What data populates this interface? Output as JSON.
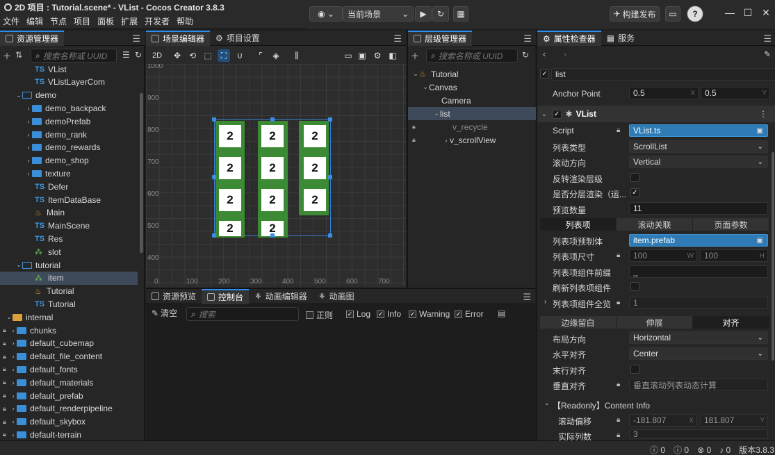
{
  "window": {
    "title": "2D 项目 : Tutorial.scene* - VList - Cocos Creator 3.8.3"
  },
  "menu": [
    "文件",
    "编辑",
    "节点",
    "项目",
    "面板",
    "扩展",
    "开发者",
    "帮助"
  ],
  "toolbar": {
    "scene_select": "当前场景",
    "build_label": "构建发布"
  },
  "assets": {
    "tab": "资源管理器",
    "search_placeholder": "搜索名称或 UUID",
    "rows": [
      "VList",
      "VListLayerCom",
      "demo",
      "demo_backpack",
      "demoPrefab",
      "demo_rank",
      "demo_rewards",
      "demo_shop",
      "texture",
      "Defer",
      "ItemDataBase",
      "Main",
      "MainScene",
      "Res",
      "slot",
      "tutorial",
      "item",
      "Tutorial",
      "Tutorial",
      "internal",
      "chunks",
      "default_cubemap",
      "default_file_content",
      "default_fonts",
      "default_materials",
      "default_prefab",
      "default_renderpipeline",
      "default_skybox",
      "default-terrain"
    ]
  },
  "scene": {
    "tab": "场景编辑器",
    "tab2": "项目设置",
    "mode": "2D",
    "yticks": [
      "1000",
      "900",
      "800",
      "700",
      "600",
      "500",
      "400"
    ],
    "xticks": [
      "0",
      "100",
      "200",
      "300",
      "400",
      "500",
      "600",
      "700"
    ],
    "cell_value": "2"
  },
  "hierarchy": {
    "tab": "层级管理器",
    "search_placeholder": "搜索名称或 UUID",
    "rows": [
      "Tutorial",
      "Canvas",
      "Camera",
      "list",
      "v_recycle",
      "v_scrollView"
    ]
  },
  "console": {
    "tabs": [
      "资源预览",
      "控制台",
      "动画编辑器",
      "动画图"
    ],
    "clear": "清空",
    "search_placeholder": "搜索",
    "regex": "正则",
    "filters": [
      "Log",
      "Info",
      "Warning",
      "Error"
    ]
  },
  "inspector": {
    "tabs": [
      "属性检查器",
      "服务"
    ],
    "node_name": "list",
    "anchor_label": "Anchor Point",
    "anchor_x": "0.5",
    "anchor_y": "0.5",
    "component": "VList",
    "script_label": "Script",
    "script_value": "VList.ts",
    "list_type_label": "列表类型",
    "list_type": "ScrollList",
    "scroll_dir_label": "滚动方向",
    "scroll_dir": "Vertical",
    "reverse_label": "反转渲染层级",
    "layered_label": "是否分层渲染（运...",
    "preview_label": "预览数量",
    "preview_count": "11",
    "seg1": [
      "列表项",
      "滚动关联",
      "页面参数"
    ],
    "prefab_label": "列表项预制体",
    "prefab_value": "item.prefab",
    "item_size_label": "列表项尺寸",
    "item_w": "100",
    "item_h": "100",
    "prefix_label": "列表项组件前缀",
    "prefix_value": "_",
    "refresh_label": "刷新列表项组件",
    "all_label": "列表项组件全览",
    "all_value": "1",
    "seg2": [
      "边缘留白",
      "伸展",
      "对齐"
    ],
    "layout_dir_label": "布局方向",
    "layout_dir": "Horizontal",
    "h_align_label": "水平对齐",
    "h_align": "Center",
    "last_row_label": "末行对齐",
    "v_align_label": "垂直对齐",
    "v_align": "垂直滚动列表动态计算",
    "readonly_label": "【Readonly】Content Info",
    "offset_label": "滚动偏移",
    "offset_x": "-181.807",
    "offset_y": "181.807",
    "cols_label": "实际列数",
    "cols_value": "3"
  },
  "status": {
    "c1": "0",
    "c2": "0",
    "c3": "0",
    "c4": "0",
    "version": "版本3.8.3"
  }
}
